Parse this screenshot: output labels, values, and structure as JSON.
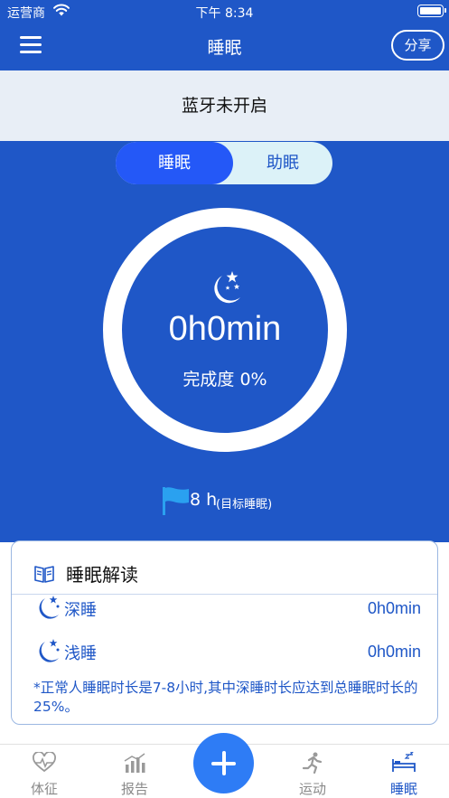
{
  "status_bar": {
    "carrier": "运营商",
    "time": "下午 8:34"
  },
  "nav": {
    "title": "睡眠",
    "share_label": "分享"
  },
  "bluetooth_banner": "蓝牙未开启",
  "segment": {
    "options": [
      "睡眠",
      "助眠"
    ],
    "selected": "睡眠"
  },
  "summary": {
    "duration": "0h0min",
    "progress_text": "完成度 0%",
    "progress_percent": 0
  },
  "goal": {
    "hours": "8 h",
    "note": "(目标睡眠)"
  },
  "interpretation": {
    "title": "睡眠解读",
    "rows": [
      {
        "label": "深睡",
        "value": "0h0min"
      },
      {
        "label": "浅睡",
        "value": "0h0min"
      }
    ],
    "tip": "*正常人睡眠时长是7-8小时,其中深睡时长应达到总睡眠时长的25%。"
  },
  "tabbar": {
    "items": [
      {
        "label": "体征",
        "icon": "heart-pulse-icon"
      },
      {
        "label": "报告",
        "icon": "bar-chart-icon"
      },
      {
        "label": "运动",
        "icon": "running-icon"
      },
      {
        "label": "睡眠",
        "icon": "bed-icon"
      }
    ],
    "active": "睡眠",
    "fab_icon": "plus-icon"
  },
  "colors": {
    "primary": "#1f57c7",
    "accent": "#2458f7",
    "fab": "#2e7cf5",
    "banner": "#e8eef6"
  }
}
